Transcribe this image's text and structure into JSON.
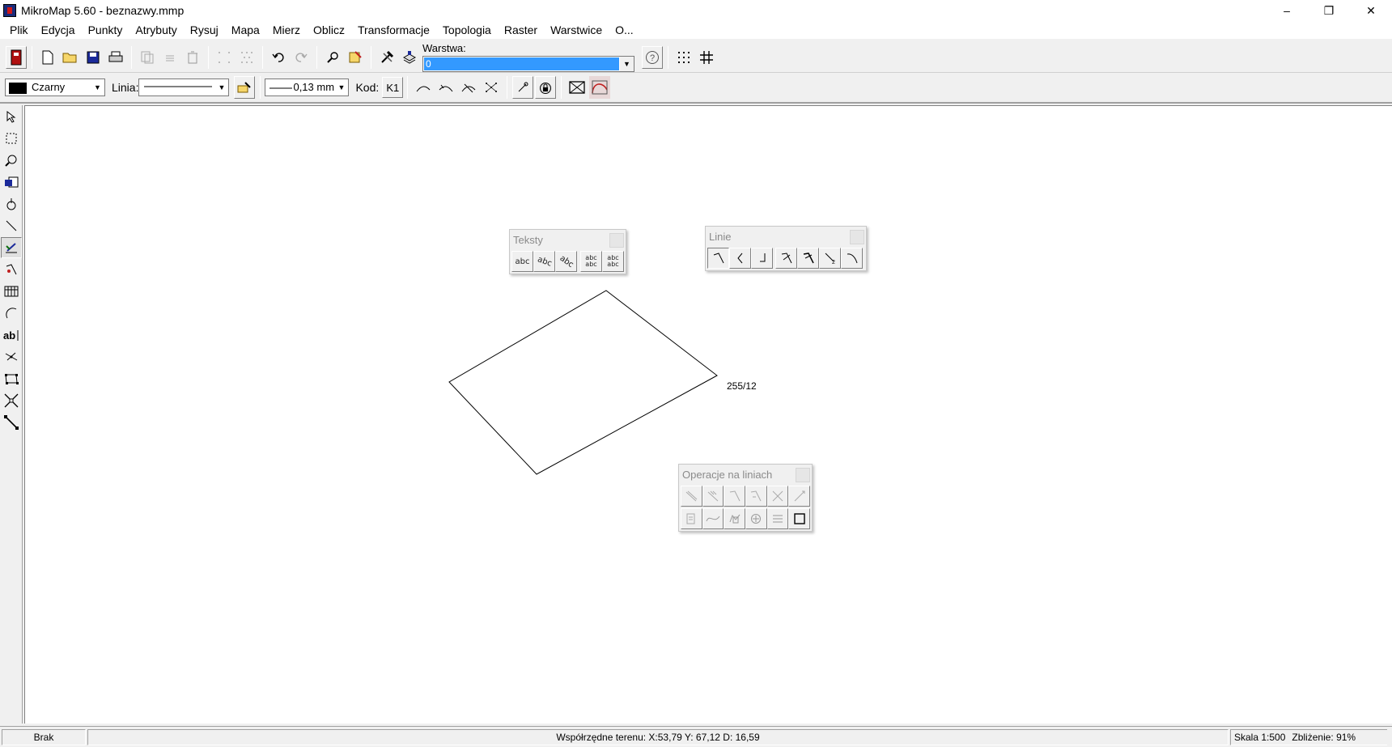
{
  "window": {
    "title": "MikroMap 5.60 - beznazwy.mmp",
    "minimize": "–",
    "restore": "❐",
    "close": "✕"
  },
  "menu": [
    "Plik",
    "Edycja",
    "Punkty",
    "Atrybuty",
    "Rysuj",
    "Mapa",
    "Mierz",
    "Oblicz",
    "Transformacje",
    "Topologia",
    "Raster",
    "Warstwice",
    "O..."
  ],
  "toolbar1": {
    "layer_label": "Warstwa:",
    "layer_value": "0"
  },
  "toolbar2": {
    "color_value": "Czarny",
    "line_label": "Linia:",
    "width_value": "0,13 mm",
    "code_label": "Kod:",
    "code_value": "K1"
  },
  "canvas": {
    "parcel_label": "255/12",
    "colors": {
      "background": "#ffffff",
      "line": "#000000"
    }
  },
  "palettes": {
    "texts": {
      "title": "Teksty",
      "buttons": [
        "abc",
        "abc",
        "abc",
        "abc abc",
        "abc abc"
      ]
    },
    "lines": {
      "title": "Linie"
    },
    "line_ops": {
      "title": "Operacje na liniach"
    }
  },
  "status": {
    "left": "Brak",
    "coords": "Współrzędne terenu: X:53,79 Y: 67,12  D: 16,59",
    "scale": "Skala 1:500",
    "zoom": "Zbliżenie: 91%"
  },
  "icons": [
    "app-logo-icon",
    "exit-icon",
    "new-file-icon",
    "open-folder-icon",
    "save-icon",
    "print-icon",
    "copy-icon",
    "list-icon",
    "trash-icon",
    "points-grid-icon",
    "undo-icon",
    "redo-icon",
    "zoom-icon",
    "paint-icon",
    "tools-icon",
    "layers-icon",
    "help-icon",
    "snap-grid-icon",
    "grid-icon"
  ]
}
